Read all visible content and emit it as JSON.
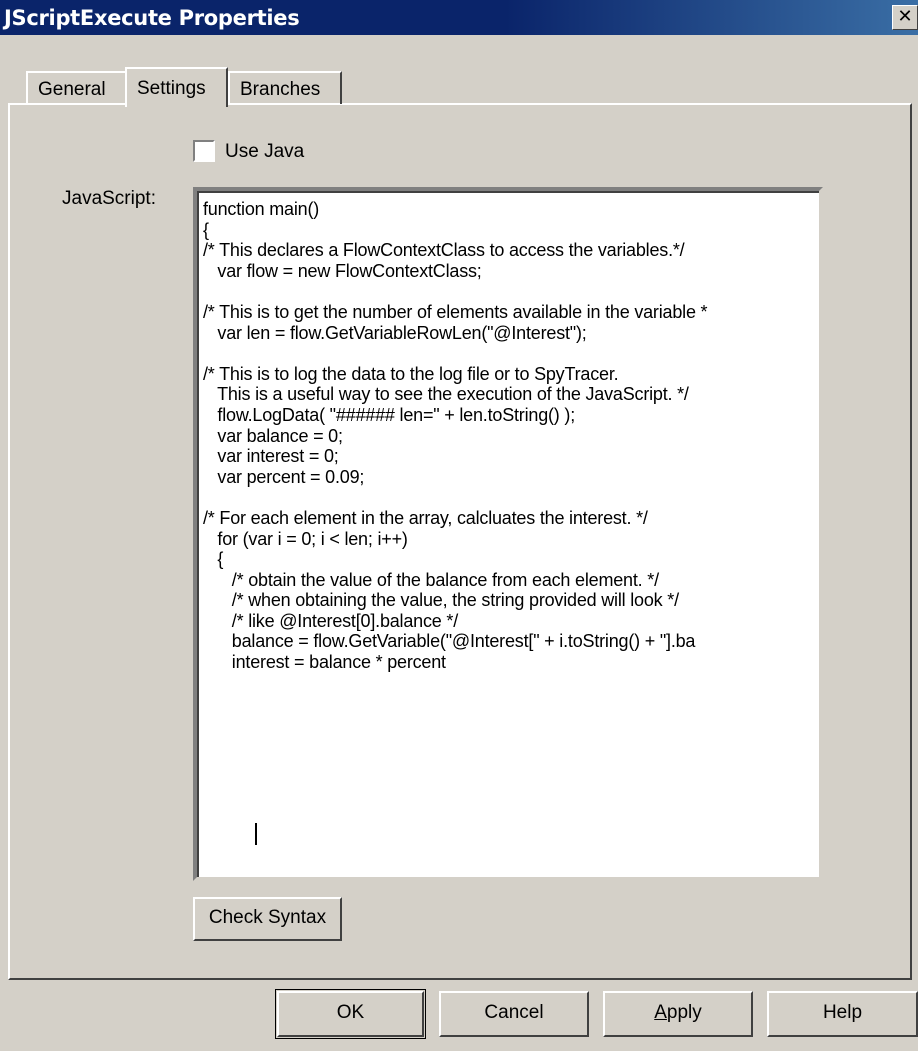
{
  "window": {
    "title": "JScriptExecute Properties",
    "close_glyph": "✕"
  },
  "tabs": [
    {
      "label": "General",
      "active": false
    },
    {
      "label": "Settings",
      "active": true
    },
    {
      "label": "Branches",
      "active": false
    }
  ],
  "settings": {
    "use_java_label": "Use Java",
    "use_java_checked": false,
    "javascript_label": "JavaScript:",
    "code": "function main()\n{\n/* This declares a FlowContextClass to access the variables.*/\n   var flow = new FlowContextClass;\n\n/* This is to get the number of elements available in the variable *\n   var len = flow.GetVariableRowLen(\"@Interest\");\n\n/* This is to log the data to the log file or to SpyTracer.\n   This is a useful way to see the execution of the JavaScript. */\n   flow.LogData( \"###### len=\" + len.toString() );\n   var balance = 0;\n   var interest = 0;\n   var percent = 0.09;\n\n/* For each element in the array, calcluates the interest. */\n   for (var i = 0; i < len; i++)\n   {\n      /* obtain the value of the balance from each element. */\n      /* when obtaining the value, the string provided will look */\n      /* like @Interest[0].balance */\n      balance = flow.GetVariable(\"@Interest[\" + i.toString() + \"].ba\n      interest = balance * percent\n",
    "check_syntax_label": "Check Syntax"
  },
  "footer": {
    "ok_label": "OK",
    "cancel_label": "Cancel",
    "apply_label_mnemonic": "A",
    "apply_label_rest": "pply",
    "help_label": "Help"
  }
}
